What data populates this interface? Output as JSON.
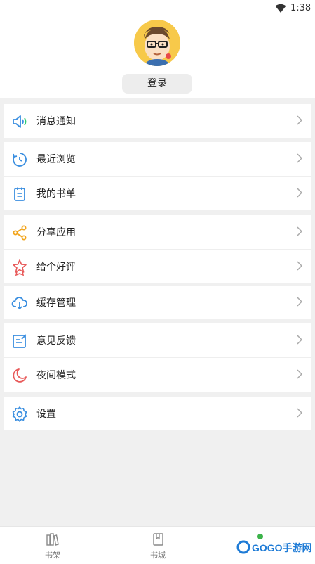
{
  "status": {
    "time": "1:38"
  },
  "profile": {
    "login_label": "登录"
  },
  "menu_groups": [
    {
      "items": [
        {
          "icon": "speaker-icon",
          "label": "消息通知"
        }
      ]
    },
    {
      "items": [
        {
          "icon": "history-icon",
          "label": "最近浏览"
        },
        {
          "icon": "booklist-icon",
          "label": "我的书单"
        }
      ]
    },
    {
      "items": [
        {
          "icon": "share-icon",
          "label": "分享应用"
        },
        {
          "icon": "star-badge-icon",
          "label": "给个好评"
        }
      ]
    },
    {
      "items": [
        {
          "icon": "cloud-download-icon",
          "label": "缓存管理"
        }
      ]
    },
    {
      "items": [
        {
          "icon": "edit-note-icon",
          "label": "意见反馈"
        },
        {
          "icon": "moon-icon",
          "label": "夜间模式"
        }
      ]
    },
    {
      "items": [
        {
          "icon": "gear-icon",
          "label": "设置"
        }
      ]
    }
  ],
  "tabs": [
    {
      "icon": "bookshelf-icon",
      "label": "书架"
    },
    {
      "icon": "bookstore-icon",
      "label": "书城"
    }
  ],
  "watermark": {
    "text": "GOGO手游网"
  },
  "colors": {
    "blue": "#3b8fe0",
    "orange": "#f2a51c",
    "red": "#e85a5a",
    "bg": "#f0f0f0"
  }
}
